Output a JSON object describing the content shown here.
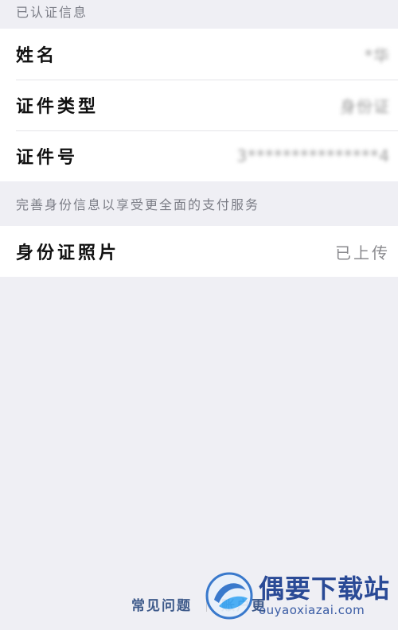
{
  "verified_section": {
    "header": "已认证信息",
    "rows": [
      {
        "label": "姓名",
        "value": "*华"
      },
      {
        "label": "证件类型",
        "value": "身份证"
      },
      {
        "label": "证件号",
        "value": "3***************4"
      }
    ]
  },
  "improve_section": {
    "header": "完善身份信息以享受更全面的支付服务",
    "rows": [
      {
        "label": "身份证照片",
        "value": "已上传"
      }
    ]
  },
  "footer": {
    "faq_label": "常见问题",
    "account_label": "账户更"
  },
  "watermark": {
    "title": "偶要下载站",
    "url": "ouyaoxiazai.com"
  }
}
